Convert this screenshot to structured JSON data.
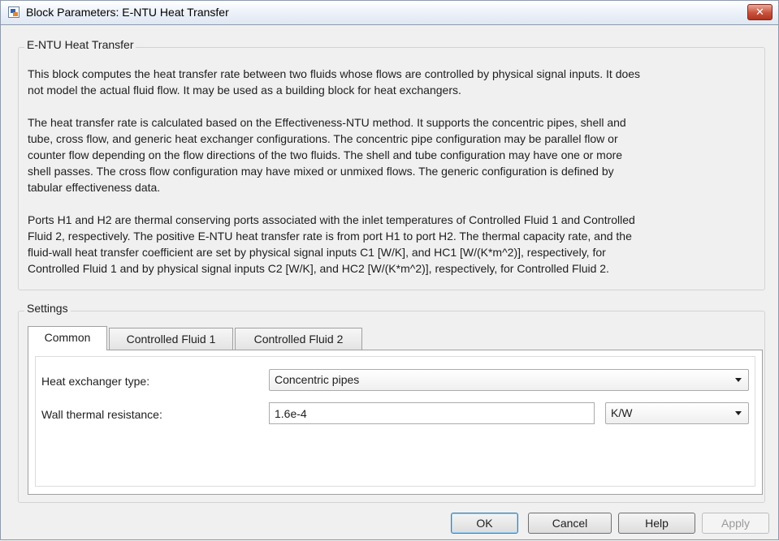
{
  "window": {
    "title": "Block Parameters: E-NTU Heat Transfer",
    "close_glyph": "✕"
  },
  "description": {
    "group_label": "E-NTU Heat Transfer",
    "paragraphs": [
      [
        "This block computes the heat transfer rate between two fluids whose flows are controlled by physical signal inputs. It does",
        "not model the actual fluid flow. It may be used as a building block for heat exchangers."
      ],
      [
        "The heat transfer rate is calculated based on the Effectiveness-NTU method. It supports the concentric pipes, shell and",
        "tube, cross flow, and generic heat exchanger configurations. The concentric pipe configuration may be parallel flow or",
        "counter flow depending on the flow directions of the two fluids. The shell and tube configuration may have one or more",
        "shell passes. The cross flow configuration may have mixed or unmixed flows. The generic configuration is defined by",
        "tabular effectiveness data."
      ],
      [
        "Ports H1 and H2 are thermal conserving ports associated with the inlet temperatures of Controlled Fluid 1 and Controlled",
        "Fluid 2, respectively. The positive E-NTU heat transfer rate is from port H1 to port H2. The thermal capacity rate, and the",
        "fluid-wall heat transfer coefficient are set by physical signal inputs C1 [W/K], and HC1 [W/(K*m^2)], respectively, for",
        "Controlled Fluid 1 and by physical signal inputs C2 [W/K], and HC2 [W/(K*m^2)], respectively, for Controlled Fluid 2."
      ]
    ]
  },
  "settings": {
    "group_label": "Settings",
    "tabs": [
      {
        "label": "Common",
        "active": true
      },
      {
        "label": "Controlled Fluid 1",
        "active": false
      },
      {
        "label": "Controlled Fluid 2",
        "active": false
      }
    ],
    "heat_exchanger_type": {
      "label": "Heat exchanger type:",
      "value": "Concentric pipes"
    },
    "wall_thermal_resistance": {
      "label": "Wall thermal resistance:",
      "value": "1.6e-4",
      "unit": "K/W"
    }
  },
  "buttons": {
    "ok": "OK",
    "cancel": "Cancel",
    "help": "Help",
    "apply": "Apply"
  },
  "icons": {
    "app": "block-parameters-icon",
    "close": "close-icon",
    "dropdown": "chevron-down-icon"
  },
  "colors": {
    "close_button": "#c9513c",
    "default_button_border": "#3c7fb1",
    "window_background": "#f0f0f0"
  }
}
